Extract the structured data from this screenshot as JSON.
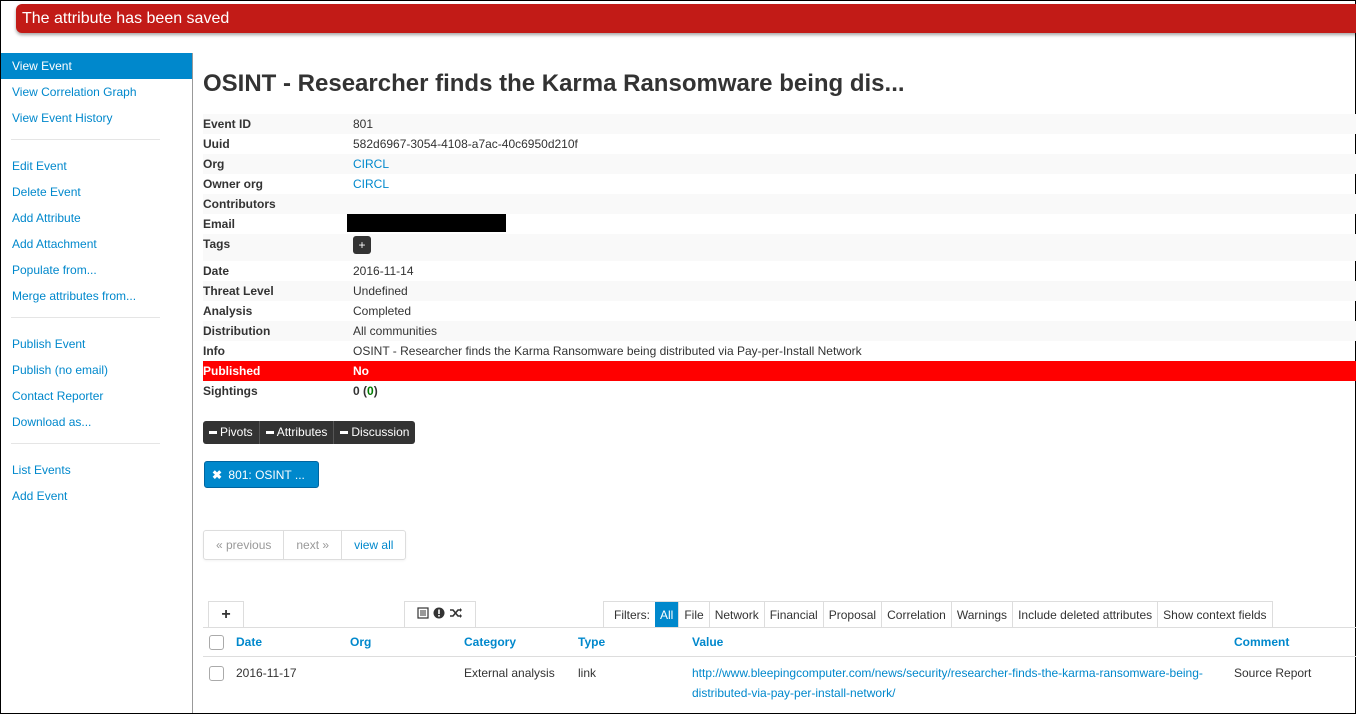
{
  "flash": {
    "message": "The attribute has been saved"
  },
  "sidebar": {
    "groups": [
      [
        "View Event",
        "View Correlation Graph",
        "View Event History"
      ],
      [
        "Edit Event",
        "Delete Event",
        "Add Attribute",
        "Add Attachment",
        "Populate from...",
        "Merge attributes from..."
      ],
      [
        "Publish Event",
        "Publish (no email)",
        "Contact Reporter",
        "Download as..."
      ],
      [
        "List Events",
        "Add Event"
      ]
    ]
  },
  "event": {
    "title": "OSINT - Researcher finds the Karma Ransomware being dis...",
    "labels": {
      "id": "Event ID",
      "uuid": "Uuid",
      "org": "Org",
      "owner_org": "Owner org",
      "contributors": "Contributors",
      "email": "Email",
      "tags": "Tags",
      "date": "Date",
      "threat_level": "Threat Level",
      "analysis": "Analysis",
      "distribution": "Distribution",
      "info": "Info",
      "published": "Published",
      "sightings": "Sightings"
    },
    "id": "801",
    "uuid": "582d6967-3054-4108-a7ac-40c6950d210f",
    "org": "CIRCL",
    "owner_org": "CIRCL",
    "contributors": "",
    "tag_add": "+",
    "date": "2016-11-14",
    "threat_level": "Undefined",
    "analysis": "Completed",
    "distribution": "All communities",
    "info": "OSINT - Researcher finds the Karma Ransomware being distributed via Pay-per-Install Network",
    "published": "No",
    "sightings_count": "0",
    "sightings_paren_open": " (",
    "sightings_inner": "0",
    "sightings_paren_close": ")"
  },
  "toggles": [
    "Pivots",
    "Attributes",
    "Discussion"
  ],
  "pivot": {
    "label": "801: OSINT ..."
  },
  "pager": {
    "previous": "« previous",
    "next": "next »",
    "view_all": "view all"
  },
  "attr_tabs": {
    "add": "+",
    "filters_label": "Filters:",
    "filters": [
      "All",
      "File",
      "Network",
      "Financial",
      "Proposal",
      "Correlation",
      "Warnings",
      "Include deleted attributes",
      "Show context fields"
    ],
    "active_filter": "All"
  },
  "table": {
    "columns": [
      "Date",
      "Org",
      "Category",
      "Type",
      "Value",
      "Comment"
    ],
    "rows": [
      {
        "date": "2016-11-17",
        "org": "",
        "category": "External analysis",
        "type": "link",
        "value": "http://www.bleepingcomputer.com/news/security/researcher-finds-the-karma-ransomware-being-distributed-via-pay-per-install-network/",
        "comment": "Source Report"
      }
    ]
  },
  "colors": {
    "accent": "#0088cc",
    "flash": "#c21b17",
    "published_bg": "#ff0000"
  }
}
